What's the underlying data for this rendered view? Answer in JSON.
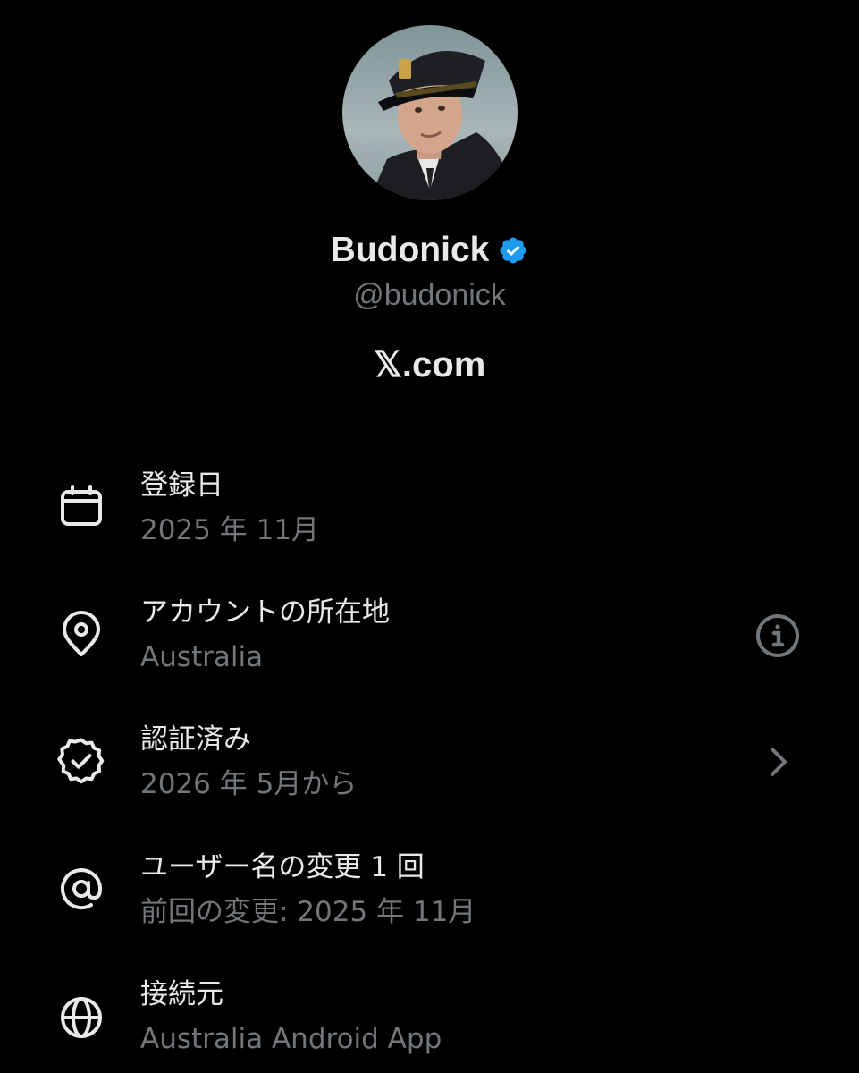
{
  "profile": {
    "display_name": "Budonick",
    "handle": "@budonick",
    "site": "𝕏.com"
  },
  "colors": {
    "background": "#000000",
    "primary_text": "#e7e9ea",
    "secondary_text": "#71767b",
    "verified_blue": "#1d9bf0"
  },
  "rows": [
    {
      "icon": "calendar-icon",
      "title": "登録日",
      "subtitle": "2025 年 11月"
    },
    {
      "icon": "location-pin-icon",
      "title": "アカウントの所在地",
      "subtitle": "Australia",
      "trailing_icon": "info-icon"
    },
    {
      "icon": "verified-badge-icon",
      "title": "認証済み",
      "subtitle": "2026 年 5月から",
      "trailing_icon": "chevron-right-icon"
    },
    {
      "icon": "at-sign-icon",
      "title": "ユーザー名の変更 1 回",
      "subtitle": "前回の変更: 2025 年 11月"
    },
    {
      "icon": "globe-icon",
      "title": "接続元",
      "subtitle": "Australia Android App"
    }
  ]
}
